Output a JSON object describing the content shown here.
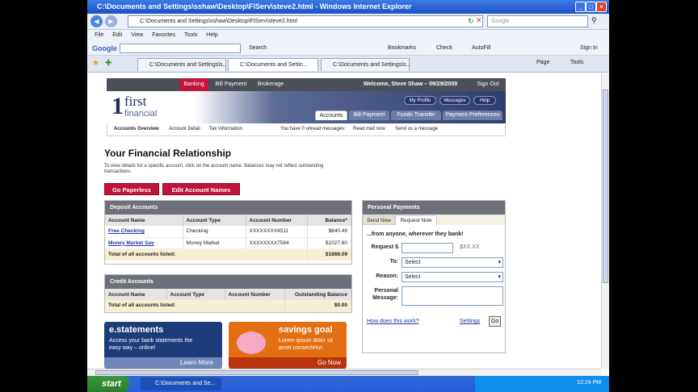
{
  "window": {
    "title": "C:\\Documents and Settings\\sshaw\\Desktop\\FIServ\\steve2.html - Windows Internet Explorer"
  },
  "address": {
    "url": "C:\\Documents and Settings\\sshaw\\Desktop\\FIServ\\steve2.html",
    "search_placeholder": "Google"
  },
  "menu": [
    "File",
    "Edit",
    "View",
    "Favorites",
    "Tools",
    "Help"
  ],
  "googlebar": {
    "logo": "Google",
    "search": "Search",
    "bookmarks": "Bookmarks",
    "check": "Check",
    "autofill": "AutoFill",
    "signin": "Sign In"
  },
  "tabs": [
    "C:\\Documents and Settings\\s...",
    "C:\\Documents and Settin...",
    "C:\\Documents and Settings\\s..."
  ],
  "toolbar_right": {
    "page": "Page",
    "tools": "Tools"
  },
  "site": {
    "topnav": {
      "banking": "Banking",
      "billpay": "Bill Payment",
      "brokerage": "Brokerage",
      "welcome": "Welcome, Steve Shaw – 09/29/2009",
      "signout": "Sign Out"
    },
    "logo": {
      "num": "1",
      "word1": "first",
      "word2": "financial"
    },
    "pills": {
      "profile": "My Profile",
      "messages": "Messages",
      "help": "Help"
    },
    "maintabs": [
      "Accounts",
      "Bill Payment",
      "Funds Transfer",
      "Payment Preferences"
    ],
    "subnav": {
      "overview": "Accounts Overview",
      "detail": "Account Detail",
      "tax": "Tax Information",
      "msgs": "You have 0 unread messages:",
      "readmail": "Read mail now",
      "send": "Send us a message"
    }
  },
  "page": {
    "title": "Your Financial Relationship",
    "intro": "To view details for a specific account, click on the account name. Balances may not reflect outstanding transactions.",
    "btn_paperless": "Go Paperless",
    "btn_edit": "Edit Account Names"
  },
  "deposit": {
    "title": "Deposit Accounts",
    "headers": [
      "Account Name",
      "Account Type",
      "Account Number",
      "Balance*"
    ],
    "rows": [
      [
        "Free Checking",
        "Checking",
        "XXXXXXXX4511",
        "$840.49"
      ],
      [
        "Money Market Sav",
        "Money Market",
        "XXXXXXXX7584",
        "$1027.60"
      ]
    ],
    "total_label": "Total of all accounts listed:",
    "total": "$1868.09"
  },
  "credit": {
    "title": "Credit Accounts",
    "headers": [
      "Account Name",
      "Account Type",
      "Account Number",
      "Outstanding Balance"
    ],
    "total_label": "Total of all accounts listed:",
    "total": "$0.00"
  },
  "payments": {
    "title": "Personal Payments",
    "tab_send": "Send Now",
    "tab_request": "Request Now",
    "tagline": "...from anyone, wherever they bank!",
    "request_label": "Request $",
    "amount_hint": "$XX.XX",
    "to_label": "To:",
    "to_value": "Select",
    "reason_label": "Reason:",
    "reason_value": "Select",
    "message_label": "Personal Message:",
    "how": "How does this work?",
    "settings": "Settings",
    "go": "Go"
  },
  "promos": {
    "estatements": {
      "title": "e.statements",
      "text": "Access your bank statements the easy way – online!",
      "link": "Learn More"
    },
    "savings": {
      "title": "savings goal",
      "text": "Lorem ipsum dolor sit amet consectetur.",
      "link": "Go Now"
    }
  },
  "taskbar": {
    "start": "start",
    "task": "C:\\Documents and Se...",
    "clock": "12:24 PM"
  },
  "colors": {
    "accent_red": "#c0143c",
    "nav_dark": "#4b4f57",
    "brand_blue": "#2e3e6e",
    "total_bg": "#f8efcf",
    "pay_bg": "#f5f1e2"
  }
}
